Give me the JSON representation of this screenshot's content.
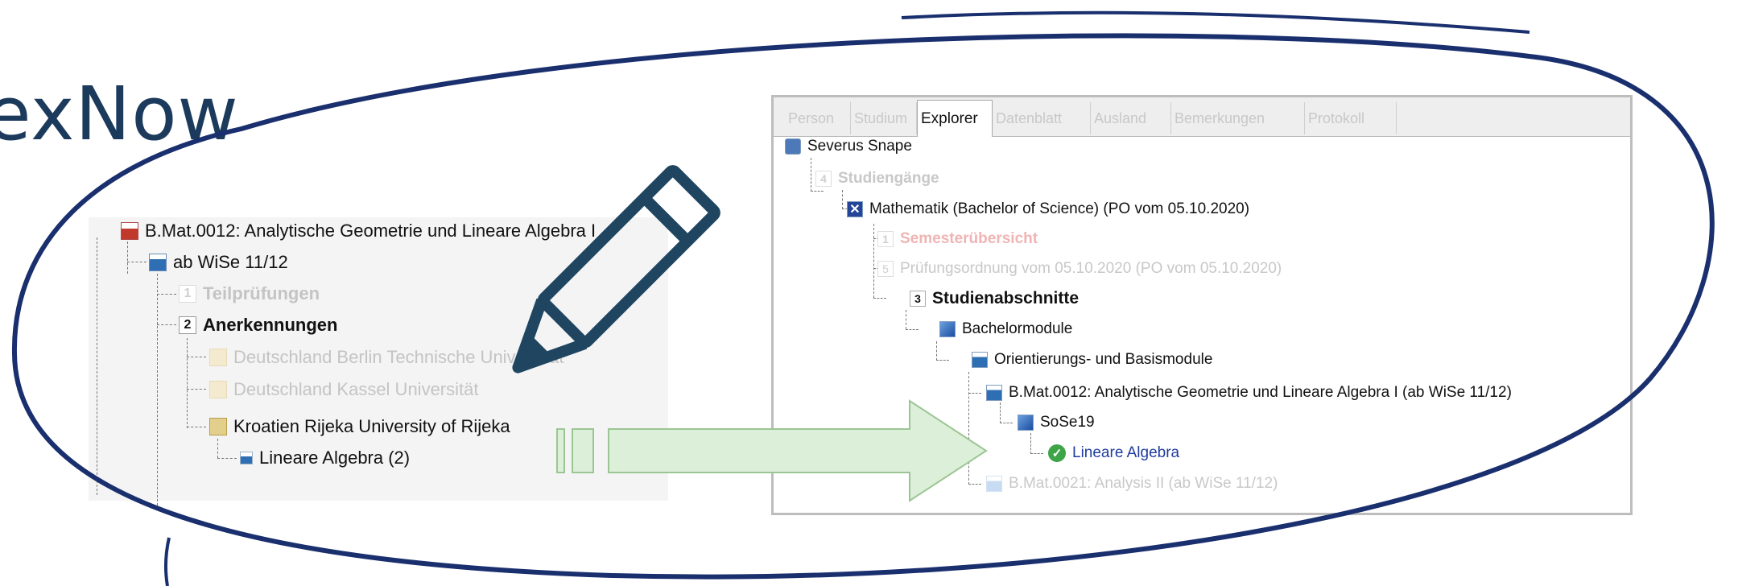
{
  "title": "exNow",
  "left_tree": {
    "items": [
      {
        "label": "B.Mat.0012: Analytische Geometrie und Lineare Algebra I",
        "icon": "module-red-icon"
      },
      {
        "label": "ab WiSe 11/12",
        "icon": "module-blue-icon"
      },
      {
        "number": "1",
        "label": "Teilprüfungen"
      },
      {
        "number": "2",
        "label": "Anerkennungen"
      },
      {
        "label": "Deutschland Berlin Technische Universität",
        "icon": "university-icon"
      },
      {
        "label": "Deutschland Kassel Universität",
        "icon": "university-icon"
      },
      {
        "label": "Kroatien Rijeka University of Rijeka",
        "icon": "university-icon"
      },
      {
        "label": "Lineare Algebra (2)",
        "icon": "course-icon"
      }
    ]
  },
  "explorer": {
    "tabs": [
      "Person",
      "Studium",
      "Explorer",
      "Datenblatt",
      "Ausland",
      "Bemerkungen",
      "Protokoll"
    ],
    "active_tab": "Explorer",
    "items": [
      {
        "label": "Severus Snape",
        "icon": "person-icon"
      },
      {
        "number": "4",
        "label": "Studiengänge"
      },
      {
        "label": "Mathematik (Bachelor of Science) (PO vom 05.10.2020)",
        "icon": "degree-icon"
      },
      {
        "number": "1",
        "label": "Semesterübersicht"
      },
      {
        "number": "5",
        "label": "Prüfungsordnung vom 05.10.2020 (PO vom 05.10.2020)"
      },
      {
        "number": "3",
        "label": "Studienabschnitte"
      },
      {
        "label": "Bachelormodule",
        "icon": "folder-icon"
      },
      {
        "label": "Orientierungs- und Basismodule",
        "icon": "folder-icon"
      },
      {
        "label": "B.Mat.0012: Analytische Geometrie und Lineare Algebra I (ab WiSe 11/12)",
        "icon": "module-icon"
      },
      {
        "label": "SoSe19",
        "icon": "semester-icon"
      },
      {
        "label": "Lineare Algebra",
        "icon": "check-icon"
      },
      {
        "label": "B.Mat.0021: Analysis II (ab WiSe 11/12)",
        "icon": "module-icon"
      }
    ]
  },
  "colors": {
    "title": "#1b3a5c",
    "ellipse": "#1a2f6e",
    "arrow_fill": "#dcefd8",
    "arrow_stroke": "#9cc594",
    "pencil": "#1f4560"
  }
}
